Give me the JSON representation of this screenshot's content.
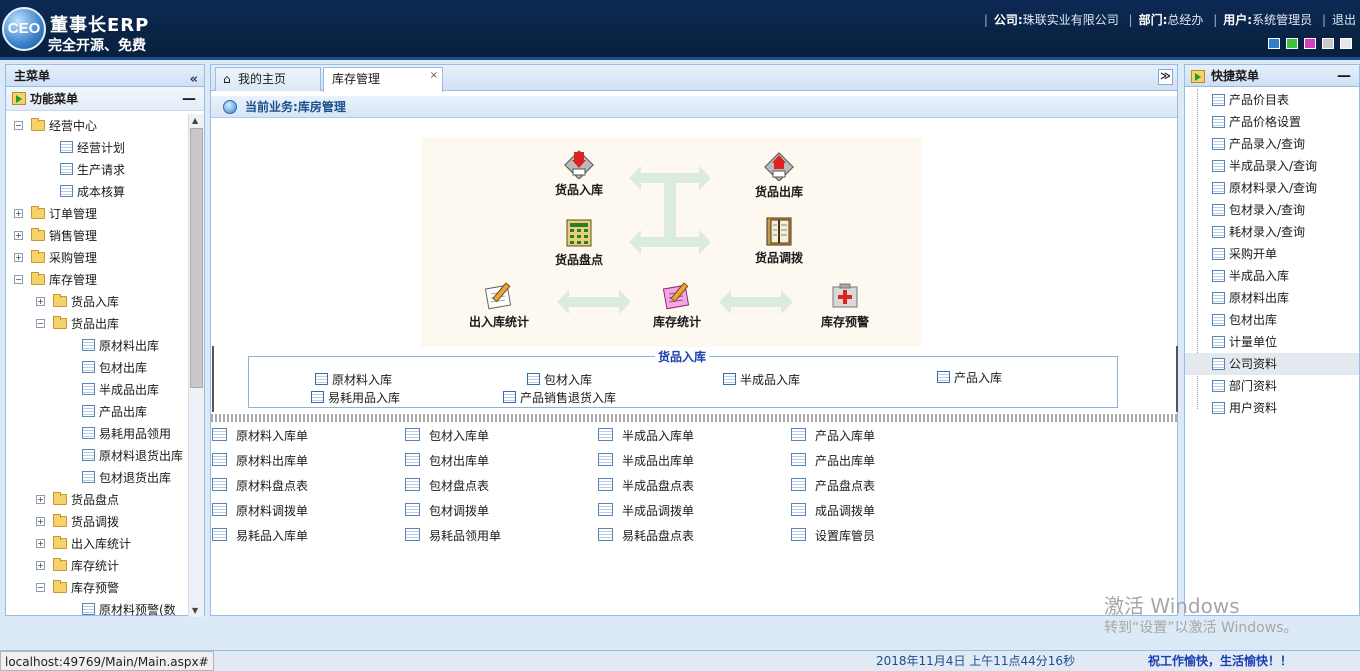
{
  "header": {
    "logo_text": "CEO",
    "title": "董事长ERP",
    "subtitle": "完全开源、免费",
    "company_label": "公司:",
    "company": "珠联实业有限公司",
    "dept_label": "部门:",
    "dept": "总经办",
    "user_label": "用户:",
    "user": "系统管理员",
    "logout": "退出",
    "theme_colors": [
      "#2f7fd0",
      "#3fbf3f",
      "#d03fbf",
      "#c8c8c8",
      "#e8e8e8"
    ]
  },
  "left_panel": {
    "title": "主菜单",
    "collapse_icon": "double-chevron-left-icon",
    "section": "功能菜单",
    "tree": [
      {
        "label": "经营中心",
        "type": "folder",
        "level": 0,
        "expanded": true
      },
      {
        "label": "经营计划",
        "type": "doc",
        "level": 1
      },
      {
        "label": "生产请求",
        "type": "doc",
        "level": 1
      },
      {
        "label": "成本核算",
        "type": "doc",
        "level": 1
      },
      {
        "label": "订单管理",
        "type": "folder",
        "level": 0,
        "expanded": false
      },
      {
        "label": "销售管理",
        "type": "folder",
        "level": 0,
        "expanded": false
      },
      {
        "label": "采购管理",
        "type": "folder",
        "level": 0,
        "expanded": false
      },
      {
        "label": "库存管理",
        "type": "folder",
        "level": 0,
        "expanded": true
      },
      {
        "label": "货品入库",
        "type": "folder",
        "level": 1,
        "expanded": false
      },
      {
        "label": "货品出库",
        "type": "folder",
        "level": 1,
        "expanded": true
      },
      {
        "label": "原材料出库",
        "type": "doc",
        "level": 2
      },
      {
        "label": "包材出库",
        "type": "doc",
        "level": 2
      },
      {
        "label": "半成品出库",
        "type": "doc",
        "level": 2
      },
      {
        "label": "产品出库",
        "type": "doc",
        "level": 2
      },
      {
        "label": "易耗用品领用",
        "type": "doc",
        "level": 2
      },
      {
        "label": "原材料退货出库",
        "type": "doc",
        "level": 2
      },
      {
        "label": "包材退货出库",
        "type": "doc",
        "level": 2
      },
      {
        "label": "货品盘点",
        "type": "folder",
        "level": 1,
        "expanded": false
      },
      {
        "label": "货品调拨",
        "type": "folder",
        "level": 1,
        "expanded": false
      },
      {
        "label": "出入库统计",
        "type": "folder",
        "level": 1,
        "expanded": false
      },
      {
        "label": "库存统计",
        "type": "folder",
        "level": 1,
        "expanded": false
      },
      {
        "label": "库存预警",
        "type": "folder",
        "level": 1,
        "expanded": true
      },
      {
        "label": "原材料预警(数",
        "type": "doc",
        "level": 2
      }
    ]
  },
  "tabs": [
    {
      "label": "我的主页",
      "active": false
    },
    {
      "label": "库存管理",
      "active": true
    }
  ],
  "current_business": {
    "label": "当前业务:",
    "value": "库房管理"
  },
  "flow": {
    "inbound": "货品入库",
    "outbound": "货品出库",
    "stocktake": "货品盘点",
    "transfer": "货品调拨",
    "io_stats": "出入库统计",
    "stock_stats": "库存统计",
    "warning": "库存预警"
  },
  "inbound_group": {
    "legend": "货品入库",
    "links": [
      "原材料入库",
      "包材入库",
      "半成品入库",
      "产品入库",
      "易耗用品入库",
      "产品销售退货入库"
    ]
  },
  "grid_links": [
    [
      "原材料入库单",
      "包材入库单",
      "半成品入库单",
      "产品入库单"
    ],
    [
      "原材料出库单",
      "包材出库单",
      "半成品出库单",
      "产品出库单"
    ],
    [
      "原材料盘点表",
      "包材盘点表",
      "半成品盘点表",
      "产品盘点表"
    ],
    [
      "原材料调拨单",
      "包材调拨单",
      "半成品调拨单",
      "成品调拨单"
    ],
    [
      "易耗品入库单",
      "易耗品领用单",
      "易耗品盘点表",
      "设置库管员"
    ]
  ],
  "right_panel": {
    "title": "快捷菜单",
    "items": [
      "产品价目表",
      "产品价格设置",
      "产品录入/查询",
      "半成品录入/查询",
      "原材料录入/查询",
      "包材录入/查询",
      "耗材录入/查询",
      "采购开单",
      "半成品入库",
      "原材料出库",
      "包材出库",
      "计量单位",
      "公司资料",
      "部门资料",
      "用户资料"
    ],
    "selected": "公司资料"
  },
  "status": {
    "url": "localhost:49769/Main/Main.aspx#",
    "datetime": "2018年11月4日 上午11点44分16秒",
    "slogan": "祝工作愉快，生活愉快！！"
  },
  "watermark": {
    "line1": "激活 Windows",
    "line2": "转到“设置”以激活 Windows。"
  }
}
